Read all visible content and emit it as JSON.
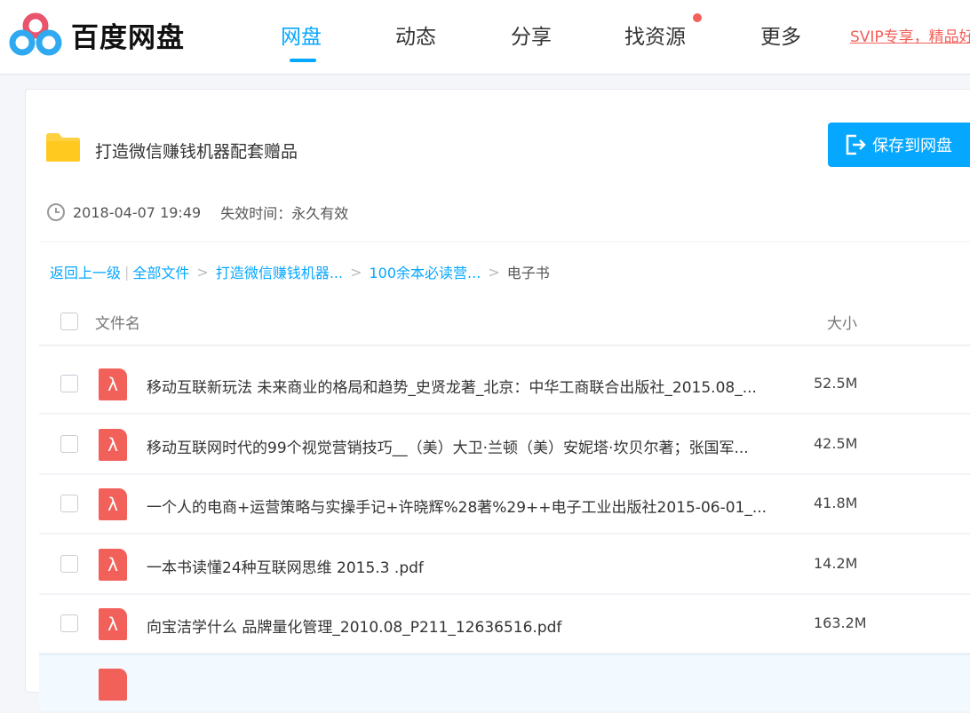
{
  "header": {
    "logo_text": "百度网盘",
    "nav": [
      "网盘",
      "动态",
      "分享",
      "找资源",
      "更多"
    ],
    "active_nav": "网盘",
    "promo": "SVIP专享，精品好"
  },
  "share": {
    "title": "打造微信赚钱机器配套赠品",
    "save_label": "保存到网盘",
    "date": "2018-04-07 19:49",
    "expire": "失效时间：永久有效"
  },
  "breadcrumb": {
    "back": "返回上一级",
    "all": "全部文件",
    "path": [
      "打造微信赚钱机器...",
      "100余本必读营..."
    ],
    "current": "电子书",
    "sep": ">"
  },
  "table": {
    "col_name": "文件名",
    "col_size": "大小",
    "rows": [
      {
        "name": "移动互联新玩法 未来商业的格局和趋势_史贤龙著_北京：中华工商联合出版社_2015.08_...",
        "size": "52.5M"
      },
      {
        "name": "移动互联网时代的99个视觉营销技巧__（美）大卫·兰顿（美）安妮塔·坎贝尔著；张国军...",
        "size": "42.5M"
      },
      {
        "name": "一个人的电商+运营策略与实操手记+许晓辉%28著%29++电子工业出版社2015-06-01_...",
        "size": "41.8M"
      },
      {
        "name": "一本书读懂24种互联网思维 2015.3 .pdf",
        "size": "14.2M"
      },
      {
        "name": "向宝洁学什么 品牌量化管理_2010.08_P211_12636516.pdf",
        "size": "163.2M"
      }
    ]
  },
  "colors": {
    "accent": "#06a7ff",
    "pdf": "#f2605a",
    "promo": "#f2605a"
  }
}
